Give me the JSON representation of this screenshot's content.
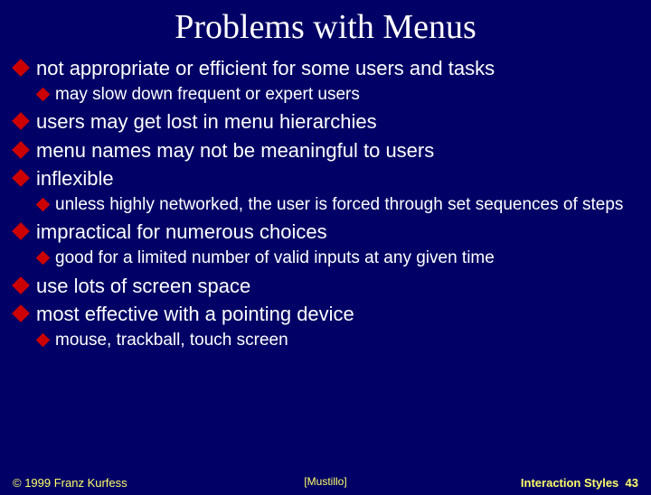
{
  "title": "Problems with Menus",
  "b1": "not appropriate or efficient for some users and tasks",
  "b1s1": "may slow down frequent or expert users",
  "b2": "users may get lost in menu hierarchies",
  "b3": "menu names may not be meaningful to users",
  "b4": "inflexible",
  "b4s1": "unless highly networked, the user is forced through set sequences of steps",
  "b5": "impractical for numerous choices",
  "b5s1": "good for a limited number of valid inputs at any given time",
  "b6": "use lots of screen space",
  "b7": "most effective with a pointing device",
  "b7s1": "mouse, trackball, touch screen",
  "footer": {
    "copyright": "© 1999 Franz Kurfess",
    "citation": "[Mustillo]",
    "section": "Interaction Styles",
    "page": "43"
  }
}
